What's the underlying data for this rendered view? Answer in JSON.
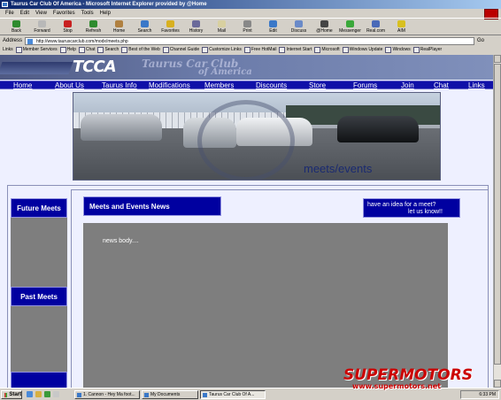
{
  "window": {
    "title": "Taurus Car Club Of America - Microsoft Internet Explorer provided by @Home"
  },
  "menu": [
    "File",
    "Edit",
    "View",
    "Favorites",
    "Tools",
    "Help"
  ],
  "toolbar": [
    {
      "label": "Back",
      "icon": "back-arrow-icon",
      "color": "#2e8b2e"
    },
    {
      "label": "Forward",
      "icon": "forward-arrow-icon",
      "color": "#b8b8b8"
    },
    {
      "label": "Stop",
      "icon": "stop-icon",
      "color": "#c82020"
    },
    {
      "label": "Refresh",
      "icon": "refresh-icon",
      "color": "#2e8b2e"
    },
    {
      "label": "Home",
      "icon": "home-icon",
      "color": "#b08040"
    },
    {
      "label": "Search",
      "icon": "search-icon",
      "color": "#3a78c8"
    },
    {
      "label": "Favorites",
      "icon": "favorites-icon",
      "color": "#d8b020"
    },
    {
      "label": "History",
      "icon": "history-icon",
      "color": "#6a6a9a"
    },
    {
      "label": "Mail",
      "icon": "mail-icon",
      "color": "#d8d0a0"
    },
    {
      "label": "Print",
      "icon": "print-icon",
      "color": "#888888"
    },
    {
      "label": "Edit",
      "icon": "edit-icon",
      "color": "#3a78c8"
    },
    {
      "label": "Discuss",
      "icon": "discuss-icon",
      "color": "#6a8ac8"
    },
    {
      "label": "@Home",
      "icon": "athome-icon",
      "color": "#444444"
    },
    {
      "label": "Messenger",
      "icon": "messenger-icon",
      "color": "#3aa83a"
    },
    {
      "label": "Real.com",
      "icon": "real-icon",
      "color": "#4a6ab8"
    },
    {
      "label": "AIM",
      "icon": "aim-icon",
      "color": "#d8c020"
    }
  ],
  "address": {
    "label": "Address",
    "url": "http://www.tauruscarclub.com/modx/meets.php",
    "go": "Go"
  },
  "links": {
    "label": "Links",
    "items": [
      "Member Services",
      "Help",
      "Chat",
      "Search",
      "Best of the Web",
      "Channel Guide",
      "Customize Links",
      "Free HotMail",
      "Internet Start",
      "Microsoft",
      "Windows Update",
      "Windows",
      "RealPlayer"
    ]
  },
  "site": {
    "logo": "TCCA",
    "logo_sub": "Taurus Car Club",
    "logo_sub2": "of America",
    "nav": [
      "Home",
      "About Us",
      "Taurus Info",
      "Modifications",
      "Members",
      "Discounts",
      "Store",
      "Forums",
      "Join",
      "Chat",
      "Links"
    ],
    "hero_caption": "meets/events",
    "future_meets": "Future Meets",
    "past_meets": "Past Meets",
    "main_title": "Meets and Events News",
    "idea_line1": "have an idea for a meet?",
    "idea_line2": "let us know!!",
    "news_body": "news body...."
  },
  "taskbar": {
    "start": "Start",
    "tasks": [
      "1. Cannon - Hey Ma foot...",
      "My Documents",
      "Taurus Car Club Of A..."
    ],
    "clock": "6:33 PM"
  },
  "watermark": {
    "line1": "SUPERMOTORS",
    "line2": "www.supermotors.net"
  }
}
